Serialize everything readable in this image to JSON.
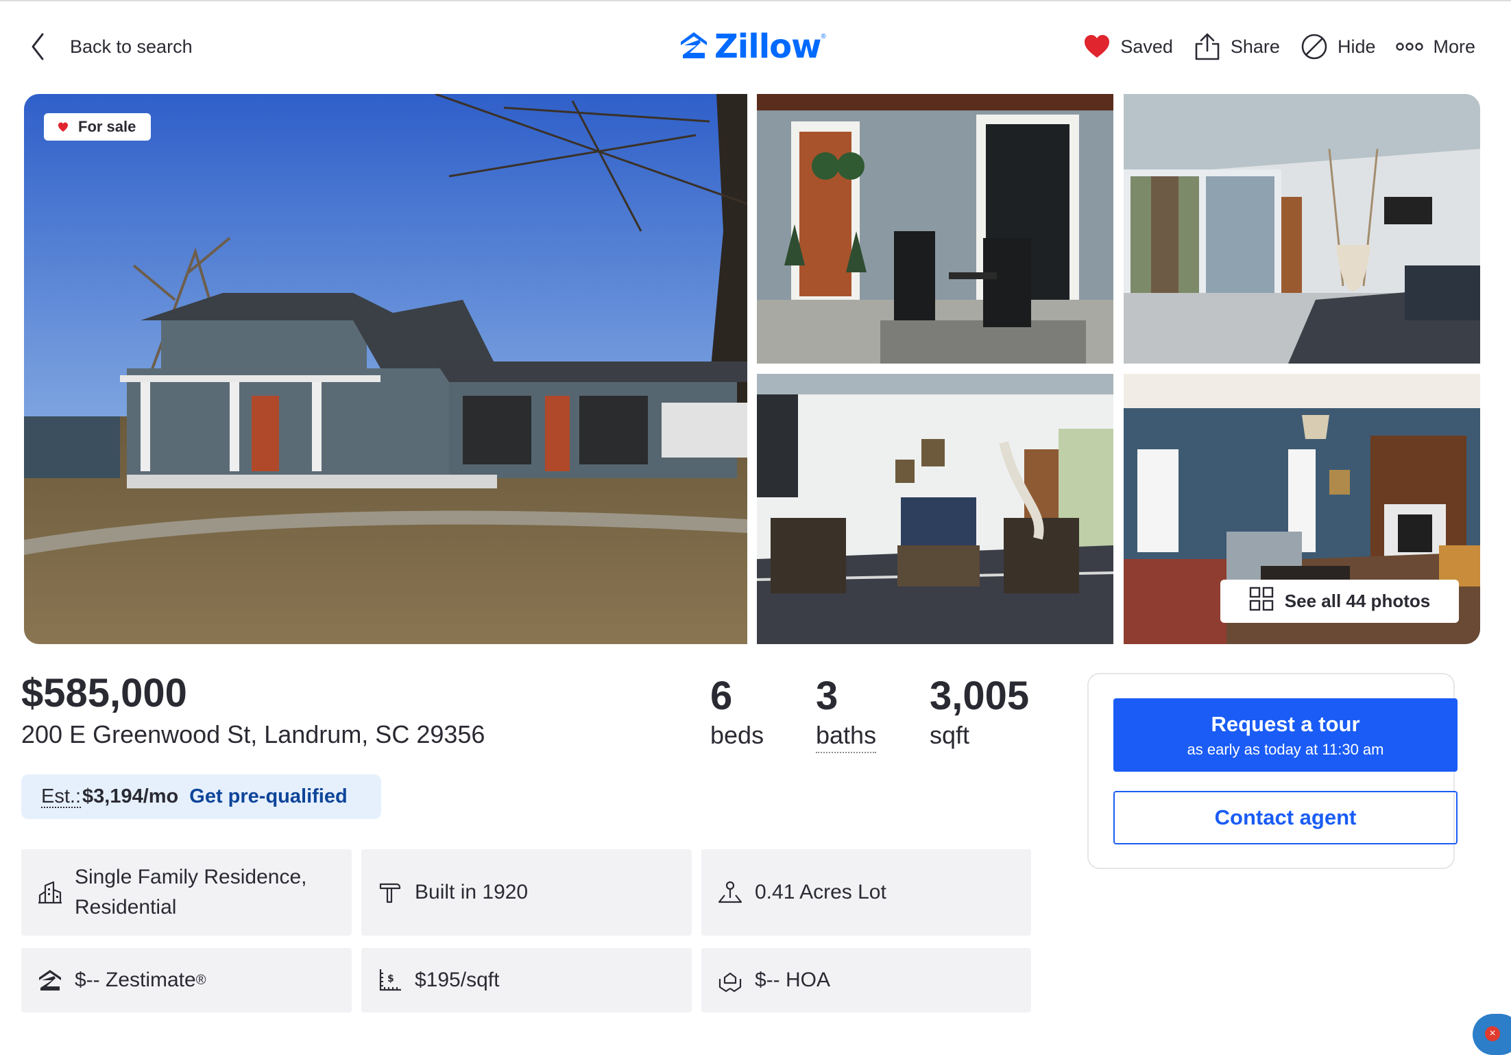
{
  "header": {
    "back_label": "Back to search",
    "logo_text": "Zillow",
    "logo_mark": "®",
    "actions": [
      {
        "label": "Saved",
        "icon": "heart-filled-icon"
      },
      {
        "label": "Share",
        "icon": "share-icon"
      },
      {
        "label": "Hide",
        "icon": "hide-icon"
      },
      {
        "label": "More",
        "icon": "more-dots-icon"
      }
    ]
  },
  "gallery": {
    "status_badge": "For sale",
    "see_all_label": "See all 44 photos"
  },
  "listing": {
    "price": "$585,000",
    "address": "200 E Greenwood St, Landrum, SC 29356",
    "beds": {
      "value": "6",
      "label": "beds"
    },
    "baths": {
      "value": "3",
      "label": "baths"
    },
    "sqft": {
      "value": "3,005",
      "label": "sqft"
    }
  },
  "estimate": {
    "prefix": "Est.:",
    "amount": "$3,194/mo",
    "link": "Get pre-qualified"
  },
  "facts": [
    {
      "text": "Single Family Residence, Residential",
      "icon": "building-icon"
    },
    {
      "text": "Built in 1920",
      "icon": "hammer-icon"
    },
    {
      "text": "0.41 Acres Lot",
      "icon": "lot-icon"
    },
    {
      "text": "$-- Zestimate",
      "sup": "®",
      "icon": "zestimate-icon"
    },
    {
      "text": "$195/sqft",
      "icon": "price-per-sqft-icon"
    },
    {
      "text": "$-- HOA",
      "icon": "hoa-icon"
    }
  ],
  "contact": {
    "tour_title": "Request a tour",
    "tour_subtitle": "as early as today at 11:30 am",
    "contact_label": "Contact agent"
  },
  "colors": {
    "brand_blue": "#006aff",
    "button_blue": "#1a5cf5",
    "link_blue": "#0d4599",
    "saved_red": "#e0252e",
    "chip_bg": "#f2f2f5"
  }
}
